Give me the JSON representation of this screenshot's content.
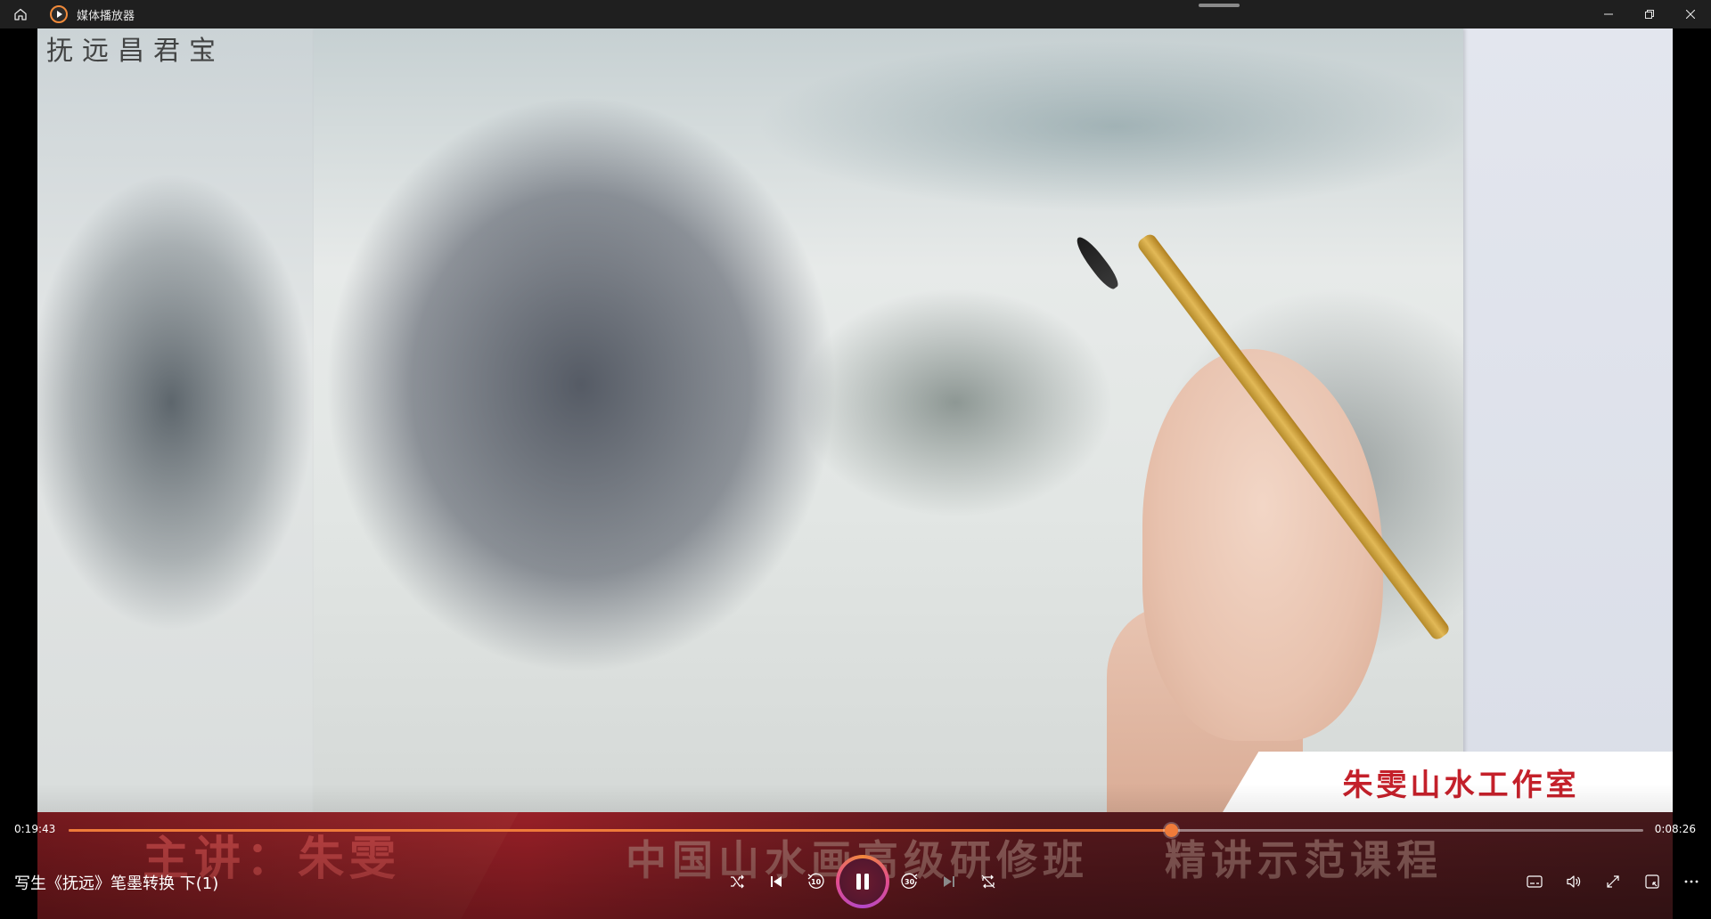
{
  "window": {
    "title": "媒体播放器",
    "controls": [
      "minimize-icon",
      "restore-icon",
      "close-icon"
    ]
  },
  "video": {
    "calligraphy": "抚远昌君宝",
    "studio_banner": "朱雯山水工作室",
    "presenter": "主讲：朱雯",
    "course_name": "中国山水画高级研修班",
    "course_tag": "精讲示范课程"
  },
  "player": {
    "current_time": "0:19:43",
    "remaining_time": "0:08:26",
    "progress_fraction": 0.7,
    "track_title": "写生《抚远》笔墨转换 下(1)",
    "transport": {
      "shuffle": "shuffle-icon",
      "previous": "previous-icon",
      "rewind_label": "10",
      "play_pause": "pause-icon",
      "forward_label": "30",
      "next": "next-icon",
      "repeat": "repeat-icon"
    },
    "right_controls": [
      "subtitles-icon",
      "volume-icon",
      "fullscreen-icon",
      "miniplayer-icon",
      "more-icon"
    ]
  },
  "colors": {
    "accent": "#ef7b3a",
    "titlebar_bg": "#1f1f1f",
    "banner_red": "#c4202a"
  }
}
